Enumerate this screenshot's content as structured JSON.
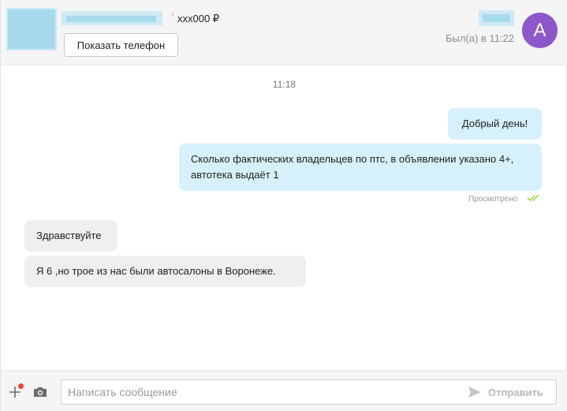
{
  "header": {
    "price": "xxx000 ₽",
    "show_phone_label": "Показать телефон",
    "last_seen": "Был(а) в 11:22",
    "avatar_letter": "А"
  },
  "chat": {
    "date_separator": "11:18",
    "messages": [
      {
        "direction": "outgoing",
        "text": "Добрый день!"
      },
      {
        "direction": "outgoing",
        "text": "Сколько фактических владельцев по птс, в объявлении указано 4+, автотека выдаёт 1"
      },
      {
        "direction": "incoming",
        "text": "Здравствуйте"
      },
      {
        "direction": "incoming",
        "text": "Я 6 ,но трое из нас были автосалоны в Воронеже."
      }
    ],
    "seen_label": "Просмотрено"
  },
  "composer": {
    "placeholder": "Написать сообщение",
    "send_label": "Отправить"
  },
  "icons": {
    "attach": "plus-icon",
    "camera": "camera-icon",
    "send": "send-arrow-icon",
    "seen": "double-check-icon"
  },
  "colors": {
    "avatar_bg": "#8e57c9",
    "outgoing_bubble": "#d6f1fb",
    "incoming_bubble": "#efefef",
    "seen_check": "#9cd33a",
    "notification_dot": "#f0433a"
  }
}
